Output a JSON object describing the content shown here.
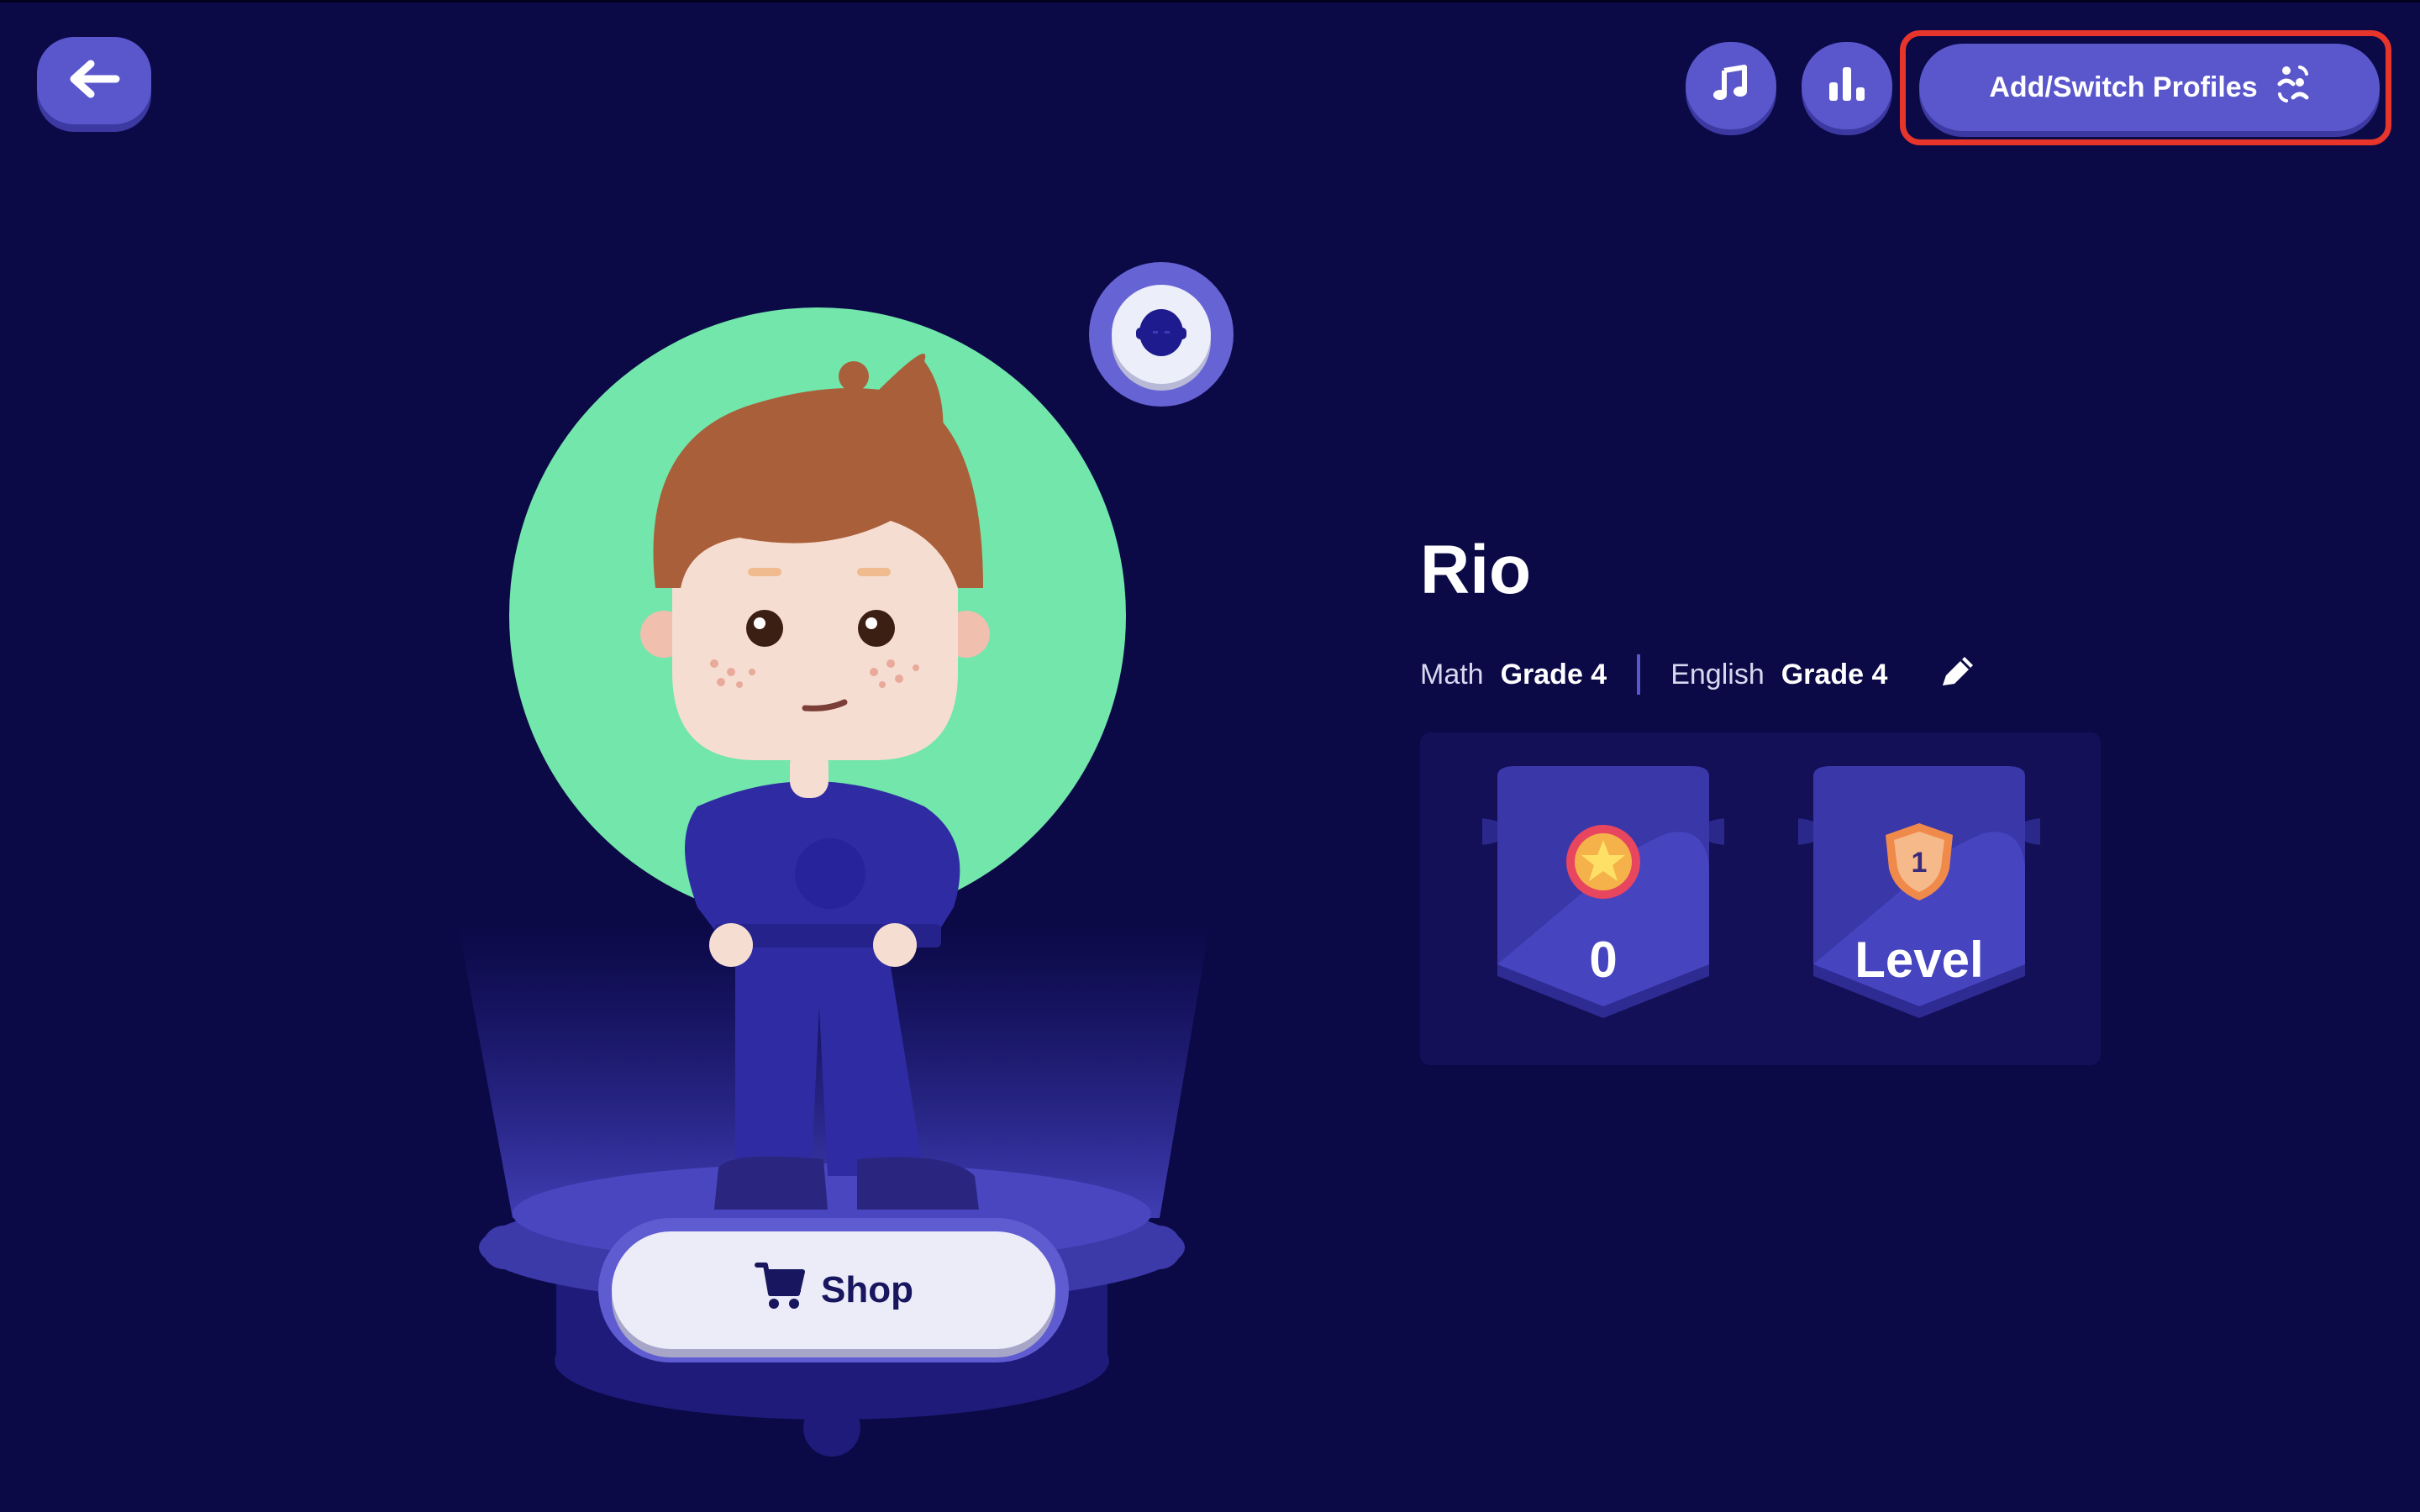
{
  "header": {
    "back_label": "back",
    "add_switch_profiles_label": "Add/Switch Profiles"
  },
  "profile": {
    "name": "Rio",
    "math_label": "Math",
    "math_grade": "Grade 4",
    "english_label": "English",
    "english_grade": "Grade 4"
  },
  "stats": {
    "stars_value": "0",
    "level_label": "Level",
    "level_number": "1"
  },
  "shop": {
    "label": "Shop"
  },
  "icons": {
    "back": "arrow-left-icon",
    "music": "music-note-icon",
    "stats": "bar-chart-icon",
    "profiles": "profiles-icon",
    "face": "avatar-face-icon",
    "edit": "pencil-icon",
    "star": "star-badge-icon",
    "level": "shield-badge-icon",
    "cart": "cart-icon"
  },
  "colors": {
    "background": "#0b0946",
    "button": "#5a57cc",
    "avatar_circle": "#72e6ab",
    "highlight": "#e8352b"
  }
}
